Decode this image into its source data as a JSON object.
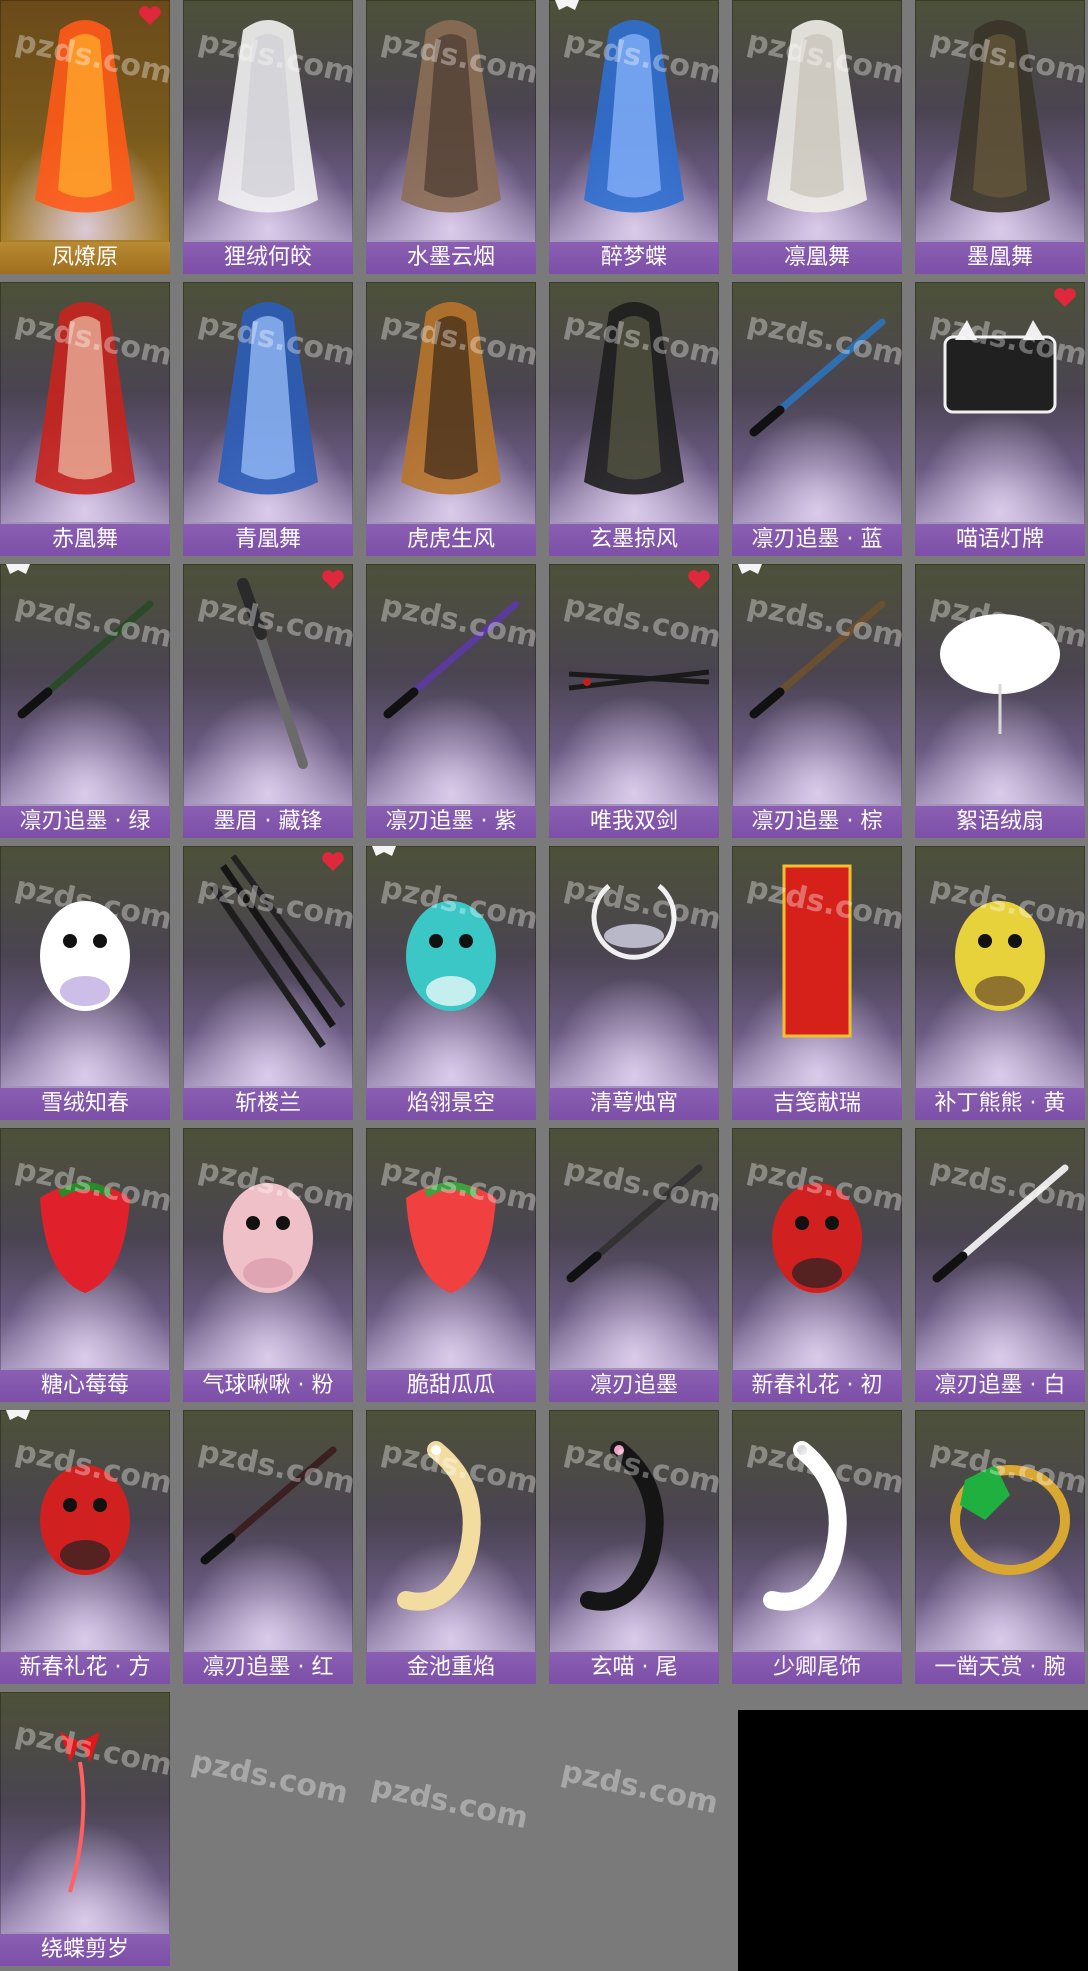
{
  "watermark": "pzds.com",
  "items": [
    {
      "label": "凤燎原",
      "icon": "flame-phoenix-outfit",
      "heart": true,
      "gold": true
    },
    {
      "label": "狸绒何皎",
      "icon": "white-fur-outfit"
    },
    {
      "label": "水墨云烟",
      "icon": "ink-robe-outfit"
    },
    {
      "label": "醉梦蝶",
      "icon": "blue-butterfly-outfit",
      "tag": true
    },
    {
      "label": "凛凰舞",
      "icon": "white-phoenix-outfit"
    },
    {
      "label": "墨凰舞",
      "icon": "dark-phoenix-outfit"
    },
    {
      "label": "赤凰舞",
      "icon": "red-phoenix-outfit"
    },
    {
      "label": "青凰舞",
      "icon": "blue-phoenix-outfit"
    },
    {
      "label": "虎虎生风",
      "icon": "tiger-robe-outfit"
    },
    {
      "label": "玄墨掠风",
      "icon": "black-cape-outfit"
    },
    {
      "label": "凛刃追墨 · 蓝",
      "icon": "blue-sword"
    },
    {
      "label": "喵语灯牌",
      "icon": "cat-light-sign",
      "heart": true
    },
    {
      "label": "凛刃追墨 · 绿",
      "icon": "green-sword",
      "tag": true
    },
    {
      "label": "墨眉 · 藏锋",
      "icon": "dark-blade",
      "heart": true
    },
    {
      "label": "凛刃追墨 · 紫",
      "icon": "purple-sword"
    },
    {
      "label": "唯我双剑",
      "icon": "twin-swords",
      "heart": true
    },
    {
      "label": "凛刃追墨 · 棕",
      "icon": "brown-sword",
      "tag": true
    },
    {
      "label": "絮语绒扇",
      "icon": "fluffy-fan"
    },
    {
      "label": "雪绒知春",
      "icon": "white-bunny-pet"
    },
    {
      "label": "斩楼兰",
      "icon": "black-sword-set",
      "heart": true
    },
    {
      "label": "焰翎景空",
      "icon": "cyan-bird-pet",
      "tag": true
    },
    {
      "label": "清萼烛宵",
      "icon": "lotus-moon-charm"
    },
    {
      "label": "吉笺献瑞",
      "icon": "red-scroll"
    },
    {
      "label": "补丁熊熊 · 黄",
      "icon": "yellow-teddy-bear"
    },
    {
      "label": "糖心莓莓",
      "icon": "strawberry"
    },
    {
      "label": "气球啾啾 · 粉",
      "icon": "pink-balloon-pet"
    },
    {
      "label": "脆甜瓜瓜",
      "icon": "watermelon-slice"
    },
    {
      "label": "凛刃追墨",
      "icon": "black-sword"
    },
    {
      "label": "新春礼花 · 初",
      "icon": "new-year-firecracker-girl"
    },
    {
      "label": "凛刃追墨 · 白",
      "icon": "white-sword"
    },
    {
      "label": "新春礼花 · 方",
      "icon": "new-year-firecracker-boy",
      "tag": true
    },
    {
      "label": "凛刃追墨 · 红",
      "icon": "red-sword"
    },
    {
      "label": "金池重焰",
      "icon": "golden-tail"
    },
    {
      "label": "玄喵 · 尾",
      "icon": "black-cat-tail"
    },
    {
      "label": "少卿尾饰",
      "icon": "white-tail"
    },
    {
      "label": "一凿天赏 · 腕",
      "icon": "emerald-bracelet"
    },
    {
      "label": "绕蝶剪岁",
      "icon": "red-butterfly-ornament"
    }
  ]
}
